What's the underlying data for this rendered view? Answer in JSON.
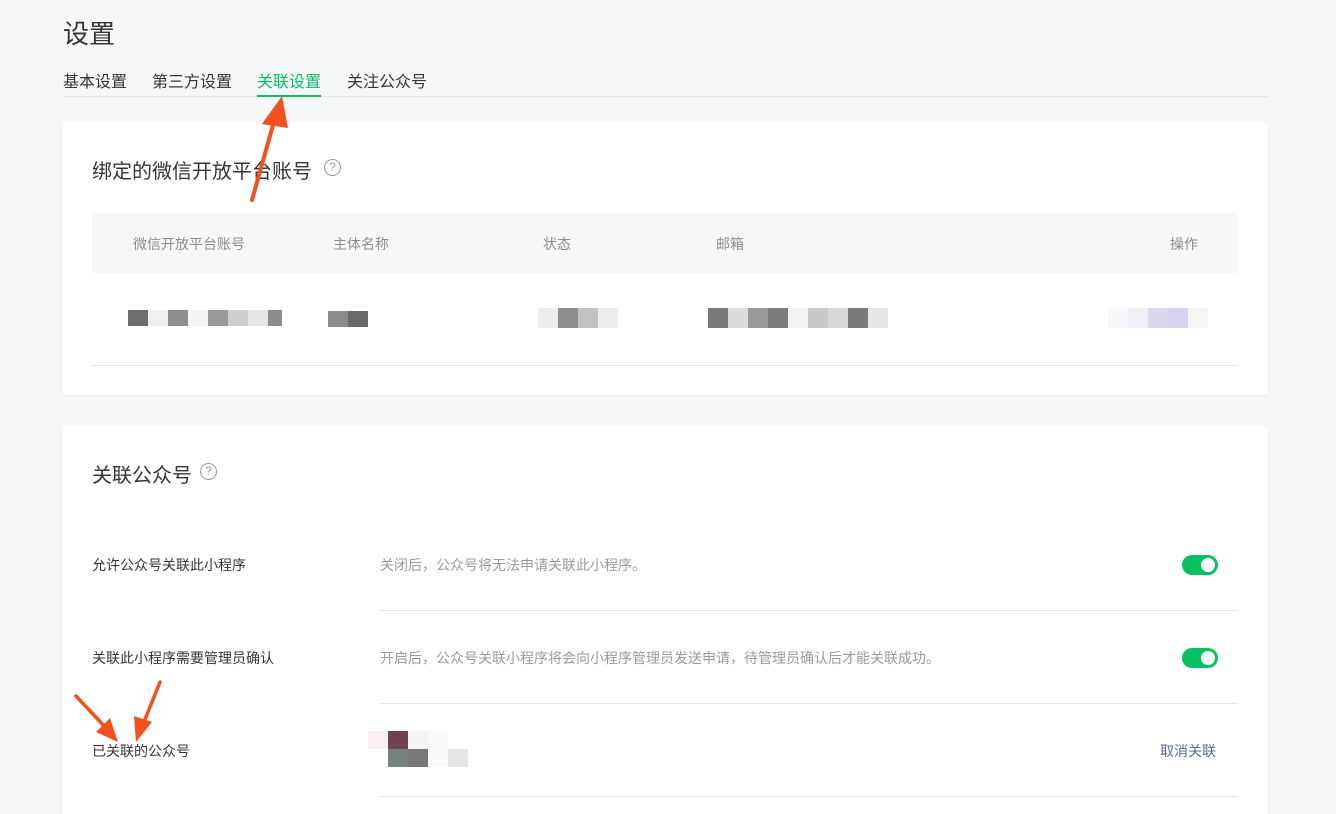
{
  "page": {
    "title": "设置"
  },
  "tabs": [
    {
      "label": "基本设置",
      "active": false
    },
    {
      "label": "第三方设置",
      "active": false
    },
    {
      "label": "关联设置",
      "active": true
    },
    {
      "label": "关注公众号",
      "active": false
    }
  ],
  "open_platform": {
    "title": "绑定的微信开放平台账号",
    "help_glyph": "?",
    "columns": [
      "微信开放平台账号",
      "主体名称",
      "状态",
      "邮箱",
      "操作"
    ]
  },
  "related_accounts": {
    "title": "关联公众号",
    "help_glyph": "?",
    "settings": [
      {
        "label": "允许公众号关联此小程序",
        "description": "关闭后，公众号将无法申请关联此小程序。",
        "enabled": true
      },
      {
        "label": "关联此小程序需要管理员确认",
        "description": "开启后，公众号关联小程序将会向小程序管理员发送申请，待管理员确认后才能关联成功。",
        "enabled": true
      }
    ],
    "linked": {
      "label": "已关联的公众号",
      "action_label": "取消关联"
    }
  },
  "colors": {
    "accent_green": "#07c160",
    "link_blue": "#576b95",
    "annotation_arrow": "#f0511e"
  }
}
